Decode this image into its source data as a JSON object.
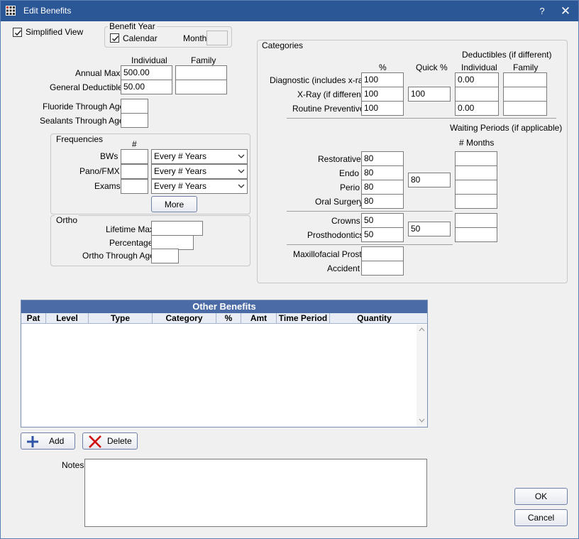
{
  "window": {
    "title": "Edit Benefits",
    "help": "?",
    "close": "✕"
  },
  "simplified_view": {
    "label": "Simplified View",
    "checked": true
  },
  "benefit_year": {
    "title": "Benefit Year",
    "calendar_label": "Calendar",
    "calendar_checked": true,
    "month_label": "Month",
    "month_value": ""
  },
  "general": {
    "individual_header": "Individual",
    "family_header": "Family",
    "annual_max_label": "Annual Max",
    "annual_max_individual": "500.00",
    "annual_max_family": "",
    "general_deductible_label": "General Deductible",
    "general_deductible_individual": "50.00",
    "general_deductible_family": "",
    "fluoride_label": "Fluoride Through Age",
    "fluoride_value": "",
    "sealants_label": "Sealants Through Age",
    "sealants_value": ""
  },
  "frequencies": {
    "title": "Frequencies",
    "hash_header": "#",
    "rows": [
      {
        "label": "BWs",
        "value": "",
        "option": "Every # Years"
      },
      {
        "label": "Pano/FMX",
        "value": "",
        "option": "Every # Years"
      },
      {
        "label": "Exams",
        "value": "",
        "option": "Every # Years"
      }
    ],
    "more_button": "More"
  },
  "ortho": {
    "title": "Ortho",
    "lifetime_max_label": "Lifetime Max",
    "lifetime_max_value": "",
    "percentage_label": "Percentage",
    "percentage_value": "",
    "through_age_label": "Ortho Through Age",
    "through_age_value": ""
  },
  "categories": {
    "title": "Categories",
    "percent_header": "%",
    "quick_header": "Quick %",
    "deductibles_header": "Deductibles (if different)",
    "individual_header": "Individual",
    "family_header": "Family",
    "diagnostic_label": "Diagnostic (includes x-ray)",
    "diagnostic_pct": "100",
    "diagnostic_ind": "0.00",
    "diagnostic_fam": "",
    "xray_label": "X-Ray (if different)",
    "xray_pct": "100",
    "xray_quick": "100",
    "xray_ind": "",
    "xray_fam": "",
    "routine_label": "Routine Preventive",
    "routine_pct": "100",
    "routine_ind": "0.00",
    "routine_fam": "",
    "waiting_header": "Waiting Periods (if applicable)",
    "months_header": "# Months",
    "restorative_label": "Restorative",
    "restorative_pct": "80",
    "endo_label": "Endo",
    "endo_pct": "80",
    "perio_label": "Perio",
    "perio_pct": "80",
    "oral_surgery_label": "Oral Surgery",
    "oral_surgery_pct": "80",
    "group1_quick": "80",
    "crowns_label": "Crowns",
    "crowns_pct": "50",
    "prostho_label": "Prosthodontics",
    "prostho_pct": "50",
    "group2_quick": "50",
    "maxillofacial_label": "Maxillofacial Prosth",
    "maxillofacial_pct": "",
    "accident_label": "Accident",
    "accident_pct": ""
  },
  "other_benefits": {
    "title": "Other Benefits",
    "columns": [
      "Pat",
      "Level",
      "Type",
      "Category",
      "%",
      "Amt",
      "Time Period",
      "Quantity"
    ],
    "rows": []
  },
  "buttons": {
    "add": "Add",
    "delete": "Delete",
    "ok": "OK",
    "cancel": "Cancel"
  },
  "notes": {
    "label": "Notes",
    "value": ""
  },
  "colors": {
    "titlebar": "#2b5797",
    "grid_header": "#4a6ba6",
    "add_icon": "#2f55a4",
    "delete_icon": "#d01010"
  }
}
